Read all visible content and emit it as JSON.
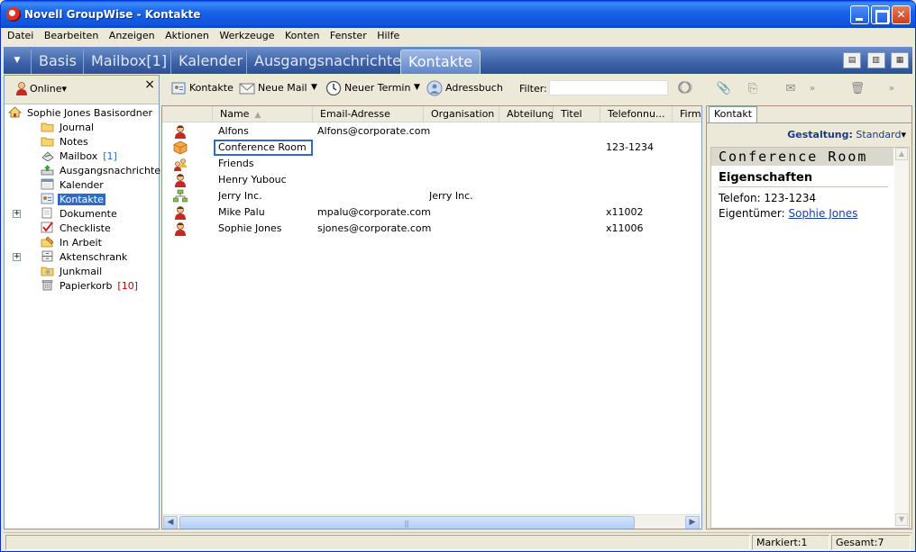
{
  "window": {
    "title": "Novell GroupWise - Kontakte"
  },
  "menu": [
    "Datei",
    "Bearbeiten",
    "Anzeigen",
    "Aktionen",
    "Werkzeuge",
    "Konten",
    "Fenster",
    "Hilfe"
  ],
  "tabs": [
    {
      "label": "Basis"
    },
    {
      "label": "Mailbox[1]"
    },
    {
      "label": "Kalender"
    },
    {
      "label": "Ausgangsnachrichten"
    },
    {
      "label": "Kontakte",
      "active": true
    }
  ],
  "left": {
    "online_label": "Online",
    "root": "Sophie Jones Basisordner",
    "folders": [
      {
        "label": "Journal",
        "icon": "folder-icon"
      },
      {
        "label": "Notes",
        "icon": "folder-icon"
      },
      {
        "label": "Mailbox",
        "icon": "mailbox-icon",
        "count": "[1]",
        "count_color": "blue"
      },
      {
        "label": "Ausgangsnachrichten",
        "icon": "outbox-icon"
      },
      {
        "label": "Kalender",
        "icon": "calendar-icon"
      },
      {
        "label": "Kontakte",
        "icon": "contacts-icon",
        "selected": true
      },
      {
        "label": "Dokumente",
        "icon": "documents-icon",
        "expander": true
      },
      {
        "label": "Checkliste",
        "icon": "checklist-icon"
      },
      {
        "label": "In Arbeit",
        "icon": "in-progress-icon"
      },
      {
        "label": "Aktenschrank",
        "icon": "cabinet-icon",
        "expander": true
      },
      {
        "label": "Junkmail",
        "icon": "junk-icon"
      },
      {
        "label": "Papierkorb",
        "icon": "trash-icon",
        "count": "[10]",
        "count_color": "red"
      }
    ]
  },
  "toolbar": {
    "contacts": "Kontakte",
    "new_mail": "Neue Mail",
    "new_appointment": "Neuer Termin",
    "address_book": "Adressbuch",
    "filter_label": "Filter:",
    "filter_value": ""
  },
  "table": {
    "columns": [
      "Name",
      "Email-Adresse",
      "Organisation",
      "Abteilung",
      "Titel",
      "Telefonnu...",
      "Firme"
    ],
    "rows": [
      {
        "icon": "person-icon",
        "name": "Alfons",
        "email": "Alfons@corporate.com",
        "org": "",
        "phone": ""
      },
      {
        "icon": "resource-icon",
        "name": "Conference Room",
        "email": "",
        "org": "",
        "phone": "123-1234",
        "editing": true
      },
      {
        "icon": "group-icon",
        "name": "Friends",
        "email": "",
        "org": "",
        "phone": ""
      },
      {
        "icon": "person-icon",
        "name": "Henry Yubouc",
        "email": "",
        "org": "",
        "phone": ""
      },
      {
        "icon": "organization-icon",
        "name": "Jerry Inc.",
        "email": "",
        "org": "Jerry Inc.",
        "phone": ""
      },
      {
        "icon": "person-icon",
        "name": "Mike Palu",
        "email": "mpalu@corporate.com",
        "org": "",
        "phone": "x11002"
      },
      {
        "icon": "person-icon",
        "name": "Sophie Jones",
        "email": "sjones@corporate.com",
        "org": "",
        "phone": "x11006"
      }
    ]
  },
  "preview": {
    "tab": "Kontakt",
    "layout_label": "Gestaltung:",
    "layout_value": "Standard",
    "heading": "Conference Room",
    "section": "Eigenschaften",
    "phone_line": "Telefon: 123-1234",
    "owner_label": "Eigentümer:",
    "owner_value": "Sophie Jones"
  },
  "status": {
    "marked": "Markiert:1",
    "total": "Gesamt:7"
  }
}
